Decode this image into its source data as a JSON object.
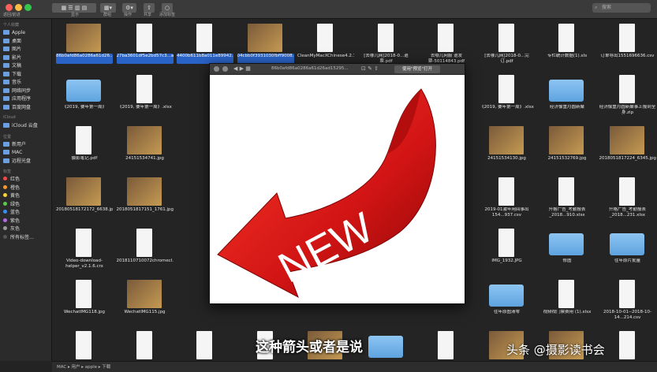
{
  "toolbar": {
    "back_label": "返回/前进",
    "view_label": "显示",
    "group_label": "群组",
    "action_label": "操作",
    "share_label": "共享",
    "tag_label": "添加标签",
    "search_placeholder": "搜索"
  },
  "sidebar": {
    "favorites_header": "个人收藏",
    "favorites": [
      "Apple",
      "桌面",
      "图片",
      "影片",
      "文稿",
      "下载",
      "音乐",
      "网络同步",
      "应用程序",
      "百度网盘"
    ],
    "icloud_header": "iCloud",
    "icloud": [
      "iCloud 云盘"
    ],
    "devices_header": "位置",
    "devices": [
      "新用户",
      "MAC",
      "远程光盘"
    ],
    "tags_header": "标签",
    "tags": [
      {
        "label": "红色",
        "color": "#f04a4a"
      },
      {
        "label": "橙色",
        "color": "#f49a30"
      },
      {
        "label": "黄色",
        "color": "#f5d33a"
      },
      {
        "label": "绿色",
        "color": "#5bc84b"
      },
      {
        "label": "蓝色",
        "color": "#3a8ef5"
      },
      {
        "label": "紫色",
        "color": "#b36be0"
      },
      {
        "label": "灰色",
        "color": "#9a9a9a"
      },
      {
        "label": "所有标签…",
        "color": "#555555"
      }
    ]
  },
  "files": [
    {
      "label": "86b0afd86a0286a61d26...78.tif.jpg",
      "meta": "",
      "thumb": "img",
      "sel": true
    },
    {
      "label": "27ba3601df5e2bd57c3...a89.tif.jpg",
      "meta": "",
      "thumb": "doc",
      "sel": true
    },
    {
      "label": "4400b611b8a011e89942...6376.jpg",
      "meta": "",
      "thumb": "doc",
      "sel": true
    },
    {
      "label": "04cbb0f3931030fbff9008...b1e.jpg",
      "meta": "",
      "thumb": "img",
      "sel": true
    },
    {
      "label": "CleanMyMacXChinese4.2.1.dmg",
      "meta": "1.38 GB",
      "thumb": "doc",
      "sel": false
    },
    {
      "label": "[去哪儿网]2018-0...退票.pdf",
      "meta": "",
      "thumb": "doc",
      "sel": false
    },
    {
      "label": "去哪儿网服 退发票-50114843.pdf",
      "meta": "",
      "thumb": "doc",
      "sel": false
    },
    {
      "label": "[去哪儿网]2018-0...完订.pdf",
      "meta": "",
      "thumb": "doc",
      "sel": false
    },
    {
      "label": "专栏统计数据(1).xls",
      "meta": "",
      "thumb": "doc",
      "sel": false
    },
    {
      "label": "订单导出1551696636.csv",
      "meta": "",
      "thumb": "doc",
      "sel": false
    },
    {
      "label": "《2019, 要年第一周》",
      "meta": "",
      "thumb": "folder",
      "sel": false
    },
    {
      "label": "《2019, 要年第一周》.xlsx",
      "meta": "",
      "thumb": "doc",
      "sel": false
    },
    {
      "label": "《2019, 要年第一周》.xlsx",
      "meta": "",
      "thumb": "doc",
      "sel": false
    },
    {
      "label": "经济像重月圆新聚",
      "meta": "",
      "thumb": "folder",
      "sel": false
    },
    {
      "label": "经济像重月圆新聚事上报到全身.zip",
      "meta": "",
      "thumb": "doc",
      "sel": false
    },
    {
      "label": "摄影笔记.pdf",
      "meta": "",
      "thumb": "doc",
      "sel": false
    },
    {
      "label": "24151534741.jpg",
      "meta": "",
      "thumb": "img",
      "sel": false
    },
    {
      "label": "24151534130.jpg",
      "meta": "",
      "thumb": "img",
      "sel": false
    },
    {
      "label": "24151532769.jpg",
      "meta": "",
      "thumb": "img",
      "sel": false
    },
    {
      "label": "2018051817224_6345.jpg",
      "meta": "",
      "thumb": "img",
      "sel": false
    },
    {
      "label": "20180518172172_6638.jpg",
      "meta": "",
      "thumb": "img",
      "sel": false
    },
    {
      "label": "2018051817151_1761.jpg",
      "meta": "",
      "thumb": "img",
      "sel": false
    },
    {
      "label": "2019-01激年用回事出154...937.csv",
      "meta": "",
      "thumb": "doc",
      "sel": false
    },
    {
      "label": "升格广告_考勤报表_2018...910.xlsx",
      "meta": "",
      "thumb": "doc",
      "sel": false
    },
    {
      "label": "升格广告_考勤报表_2018...231.xlsx",
      "meta": "",
      "thumb": "doc",
      "sel": false
    },
    {
      "label": "Video-download-helper_v2.1.6.crx",
      "meta": "",
      "thumb": "doc",
      "sel": false
    },
    {
      "label": "2018110710072chromecl.com.zip",
      "meta": "",
      "thumb": "doc",
      "sel": false
    },
    {
      "label": "IMG_1932.JPG",
      "meta": "",
      "thumb": "doc",
      "sel": false
    },
    {
      "label": "修图",
      "meta": "",
      "thumb": "folder",
      "sel": false
    },
    {
      "label": "往年原片批量",
      "meta": "",
      "thumb": "folder",
      "sel": false
    },
    {
      "label": "WechatIMG118.jpg",
      "meta": "",
      "thumb": "doc",
      "sel": false
    },
    {
      "label": "WechatIMG115.jpg",
      "meta": "",
      "thumb": "img",
      "sel": false
    },
    {
      "label": "往年原图清零",
      "meta": "",
      "thumb": "folder",
      "sel": false
    },
    {
      "label": "视频视门票费用 (1).xlsx",
      "meta": "",
      "thumb": "doc",
      "sel": false
    },
    {
      "label": "2018-10-01--2018-10-14...214.csv",
      "meta": "",
      "thumb": "doc",
      "sel": false
    },
    {
      "label": "升格广告_考勤报表_20181018.csv",
      "meta": "",
      "thumb": "doc",
      "sel": false
    },
    {
      "label": "2018-10-01--2018-10-14...930.xlsx",
      "meta": "",
      "thumb": "doc",
      "sel": false
    },
    {
      "label": "风景摄影入门与二维码.pdf",
      "meta": "",
      "thumb": "doc",
      "sel": false
    },
    {
      "label": "1539588914.pdf",
      "meta": "",
      "thumb": "doc",
      "sel": false
    },
    {
      "label": "WechatIMG107.jpg",
      "meta": "",
      "thumb": "img",
      "sel": false
    },
    {
      "label": "Camera",
      "meta": "",
      "thumb": "folder",
      "sel": false
    },
    {
      "label": "WechatIMG7.jpeg",
      "meta": "",
      "thumb": "doc",
      "sel": false
    },
    {
      "label": "24151537567.jpg",
      "meta": "",
      "thumb": "img",
      "sel": false
    },
    {
      "label": "24151536184.jpg",
      "meta": "",
      "thumb": "img",
      "sel": false
    },
    {
      "label": "24151535087.jpg",
      "meta": "",
      "thumb": "doc",
      "sel": false
    },
    {
      "label": "timg-8.jpeg",
      "meta": "",
      "thumb": "img",
      "sel": false
    },
    {
      "label": "timg-5.jpeg",
      "meta": "",
      "thumb": "img",
      "sel": false
    },
    {
      "label": "WechatIMG84.jpeg",
      "meta": "",
      "thumb": "img",
      "sel": false
    },
    {
      "label": "20180518172132_7825.jpg",
      "meta": "",
      "thumb": "img",
      "sel": false
    },
    {
      "label": "expose.n-s4.0.2...download",
      "meta": "",
      "thumb": "doc",
      "sel": false
    },
    {
      "label": "timg-4.jpeg",
      "meta": "",
      "thumb": "img",
      "sel": false
    },
    {
      "label": "timg-3.jpeg",
      "meta": "",
      "thumb": "img",
      "sel": false
    },
    {
      "label": "264a38-14042P22480.jpg",
      "meta": "",
      "thumb": "img",
      "sel": false
    },
    {
      "label": "2018-1熟年用回事出18.11.06.jpg",
      "meta": "",
      "thumb": "doc",
      "sel": false
    },
    {
      "label": "2c8573bf3cfe2e00f06b...5ee.jpeg",
      "meta": "",
      "thumb": "doc",
      "sel": false
    },
    {
      "label": "e07208e1b68e36992880...a.jpg.gif",
      "meta": "",
      "thumb": "doc",
      "sel": false
    },
    {
      "label": "timg-2.jpeg",
      "meta": "",
      "thumb": "doc",
      "sel": false
    },
    {
      "label": "默认标题_手机海报_2018...2.jpg",
      "meta": "",
      "thumb": "doc",
      "sel": false
    },
    {
      "label": "视频号10月18日至31日订单.csv",
      "meta": "",
      "thumb": "doc",
      "sel": false
    },
    {
      "label": "2018-10-01--2018-10-31...770.csv",
      "meta": "",
      "thumb": "doc",
      "sel": false
    },
    {
      "label": "CleanMyMac3.dmg",
      "meta": "",
      "thumb": "doc",
      "sel": false
    }
  ],
  "quicklook": {
    "title": "86b0afd86a0286a61d26ad15295...",
    "open_with": "使用\"预览\"打开",
    "word": "NEW"
  },
  "pathbar": {
    "text": "MAC ▸ 用户 ▸ apple ▸ 下载"
  },
  "overlay": {
    "subtitle": "这种箭头或者是说",
    "watermark": "头条 @摄影读书会"
  }
}
